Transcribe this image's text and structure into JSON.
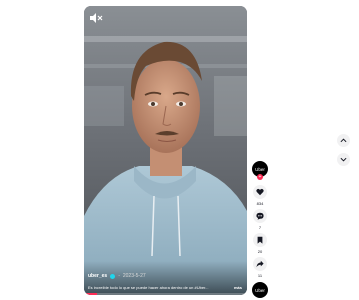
{
  "video": {
    "username": "uber_es",
    "date": "2023-5-27",
    "caption": "Es increíble todo lo que se puede hacer ahora dentro de un #Uber...",
    "more_label": "más",
    "progress": 0.08
  },
  "rail": {
    "avatar_label": "Uber",
    "follow_symbol": "+",
    "like_count": "834",
    "comment_count": "7",
    "save_count": "20",
    "share_count": "11",
    "sound_avatar_label": "Uber"
  },
  "icons": {
    "mute": "volume-muted-icon",
    "like": "heart-icon",
    "comment": "comment-bubble-icon",
    "save": "bookmark-icon",
    "share": "share-arrow-icon",
    "up": "chevron-up-icon",
    "down": "chevron-down-icon"
  },
  "colors": {
    "accent": "#fe2c55",
    "verified": "#20d5ec",
    "button_bg": "#f1f1f2"
  }
}
